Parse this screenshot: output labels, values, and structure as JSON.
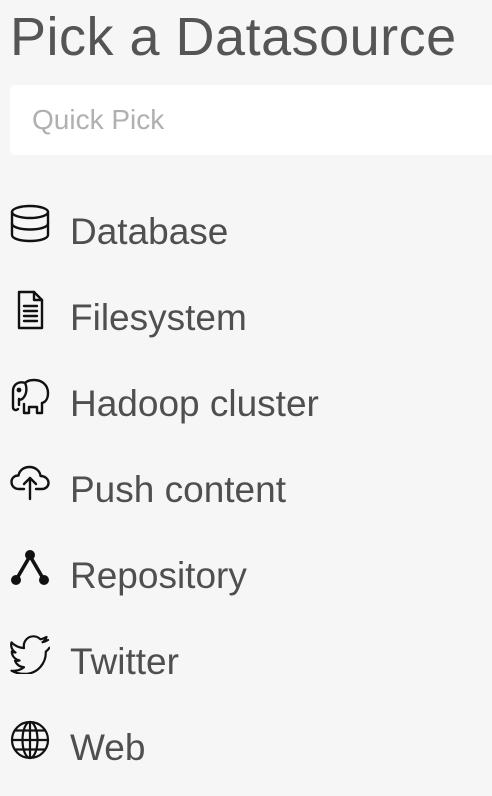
{
  "header": {
    "title": "Pick a Datasource"
  },
  "search": {
    "placeholder": "Quick Pick",
    "value": ""
  },
  "datasources": [
    {
      "label": "Database",
      "icon": "database-icon"
    },
    {
      "label": "Filesystem",
      "icon": "file-icon"
    },
    {
      "label": "Hadoop cluster",
      "icon": "elephant-icon"
    },
    {
      "label": "Push content",
      "icon": "cloud-upload-icon"
    },
    {
      "label": "Repository",
      "icon": "repository-icon"
    },
    {
      "label": "Twitter",
      "icon": "twitter-bird-icon"
    },
    {
      "label": "Web",
      "icon": "globe-icon"
    }
  ],
  "colors": {
    "background": "#f6f6f6",
    "text": "#4a4a4a",
    "placeholder": "#b0b0b0",
    "input_background": "#ffffff"
  }
}
